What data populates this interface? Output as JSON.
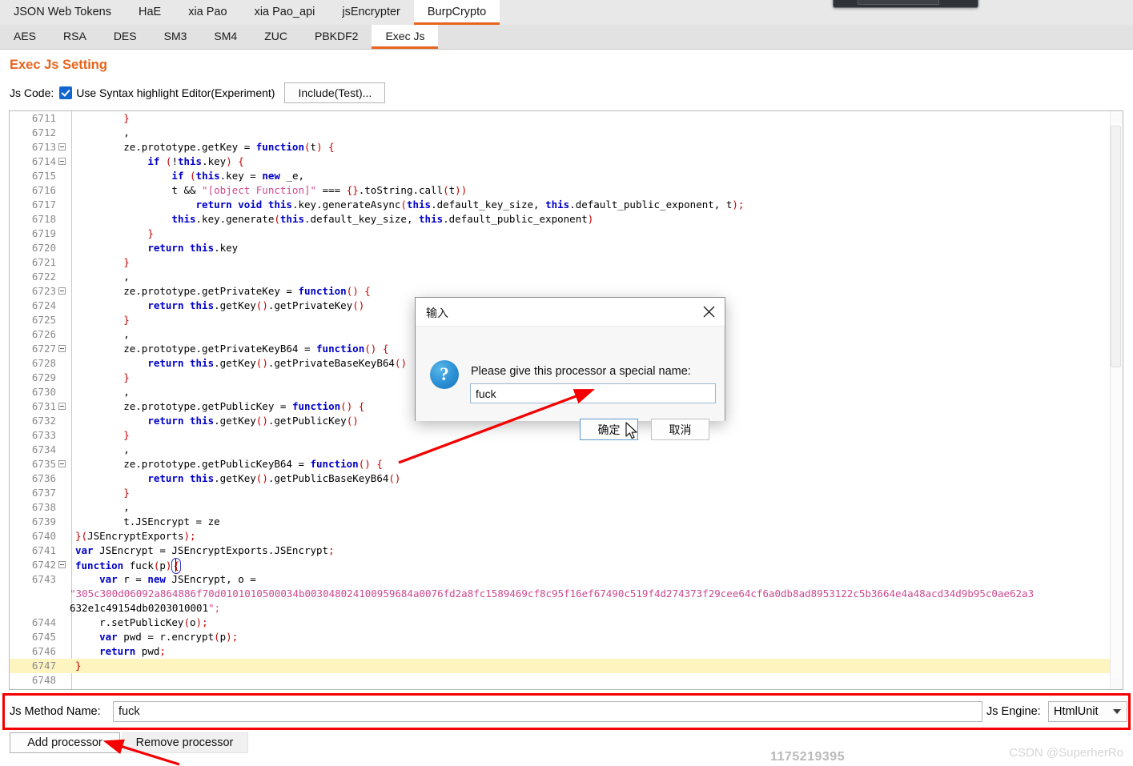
{
  "top_tabs": [
    {
      "label": "JSON Web Tokens",
      "active": false
    },
    {
      "label": "HaE",
      "active": false
    },
    {
      "label": "xia Pao",
      "active": false
    },
    {
      "label": "xia Pao_api",
      "active": false
    },
    {
      "label": "jsEncrypter",
      "active": false
    },
    {
      "label": "BurpCrypto",
      "active": true
    }
  ],
  "sub_tabs": [
    {
      "label": "AES",
      "active": false
    },
    {
      "label": "RSA",
      "active": false
    },
    {
      "label": "DES",
      "active": false
    },
    {
      "label": "SM3",
      "active": false
    },
    {
      "label": "SM4",
      "active": false
    },
    {
      "label": "ZUC",
      "active": false
    },
    {
      "label": "PBKDF2",
      "active": false
    },
    {
      "label": "Exec Js",
      "active": true
    }
  ],
  "section": {
    "title": "Exec Js Setting",
    "js_code_label": "Js Code:",
    "syntax_checkbox_label": "Use Syntax highlight Editor(Experiment)",
    "syntax_checkbox_checked": true,
    "include_button": "Include(Test)..."
  },
  "editor": {
    "first_line": 6711,
    "highlighted_line": 6747,
    "lines": [
      {
        "n": "6711",
        "fold": false,
        "text": "        }"
      },
      {
        "n": "6712",
        "fold": false,
        "text": "        ,"
      },
      {
        "n": "6713",
        "fold": true,
        "text": "        ze.prototype.getKey = function(t) {"
      },
      {
        "n": "6714",
        "fold": true,
        "text": "            if (!this.key) {"
      },
      {
        "n": "6715",
        "fold": false,
        "text": "                if (this.key = new _e,"
      },
      {
        "n": "6716",
        "fold": false,
        "text": "                t && \"[object Function]\" === {}.toString.call(t))"
      },
      {
        "n": "6717",
        "fold": false,
        "text": "                    return void this.key.generateAsync(this.default_key_size, this.default_public_exponent, t);"
      },
      {
        "n": "6718",
        "fold": false,
        "text": "                this.key.generate(this.default_key_size, this.default_public_exponent)"
      },
      {
        "n": "6719",
        "fold": false,
        "text": "            }"
      },
      {
        "n": "6720",
        "fold": false,
        "text": "            return this.key"
      },
      {
        "n": "6721",
        "fold": false,
        "text": "        }"
      },
      {
        "n": "6722",
        "fold": false,
        "text": "        ,"
      },
      {
        "n": "6723",
        "fold": true,
        "text": "        ze.prototype.getPrivateKey = function() {"
      },
      {
        "n": "6724",
        "fold": false,
        "text": "            return this.getKey().getPrivateKey()"
      },
      {
        "n": "6725",
        "fold": false,
        "text": "        }"
      },
      {
        "n": "6726",
        "fold": false,
        "text": "        ,"
      },
      {
        "n": "6727",
        "fold": true,
        "text": "        ze.prototype.getPrivateKeyB64 = function() {"
      },
      {
        "n": "6728",
        "fold": false,
        "text": "            return this.getKey().getPrivateBaseKeyB64()"
      },
      {
        "n": "6729",
        "fold": false,
        "text": "        }"
      },
      {
        "n": "6730",
        "fold": false,
        "text": "        ,"
      },
      {
        "n": "6731",
        "fold": true,
        "text": "        ze.prototype.getPublicKey = function() {"
      },
      {
        "n": "6732",
        "fold": false,
        "text": "            return this.getKey().getPublicKey()"
      },
      {
        "n": "6733",
        "fold": false,
        "text": "        }"
      },
      {
        "n": "6734",
        "fold": false,
        "text": "        ,"
      },
      {
        "n": "6735",
        "fold": true,
        "text": "        ze.prototype.getPublicKeyB64 = function() {"
      },
      {
        "n": "6736",
        "fold": false,
        "text": "            return this.getKey().getPublicBaseKeyB64()"
      },
      {
        "n": "6737",
        "fold": false,
        "text": "        }"
      },
      {
        "n": "6738",
        "fold": false,
        "text": "        ,"
      },
      {
        "n": "6739",
        "fold": false,
        "text": "        t.JSEncrypt = ze"
      },
      {
        "n": "6740",
        "fold": false,
        "text": "}(JSEncryptExports);"
      },
      {
        "n": "6741",
        "fold": false,
        "text": "var JSEncrypt = JSEncryptExports.JSEncrypt;"
      },
      {
        "n": "6742",
        "fold": true,
        "text": "function fuck(p){"
      },
      {
        "n": "6743",
        "fold": false,
        "text": "    var r = new JSEncrypt, o ="
      },
      {
        "n": "",
        "fold": false,
        "text": "\"305c300d06092a864886f70d0101010500034b003048024100959684a0076fd2a8fc1589469cf8c95f16ef67490c519f4d274373f29cee64cf6a0db8ad8953122c5b3664e4a48acd34d9b95c0ae62a3"
      },
      {
        "n": "",
        "fold": false,
        "text": "632e1c49154db0203010001\";"
      },
      {
        "n": "6744",
        "fold": false,
        "text": "    r.setPublicKey(o);"
      },
      {
        "n": "6745",
        "fold": false,
        "text": "    var pwd = r.encrypt(p);"
      },
      {
        "n": "6746",
        "fold": false,
        "text": "    return pwd;"
      },
      {
        "n": "6747",
        "fold": false,
        "text": "}"
      },
      {
        "n": "6748",
        "fold": false,
        "text": ""
      }
    ]
  },
  "dialog": {
    "title": "输入",
    "prompt": "Please give this processor a special name:",
    "input_value": "fuck",
    "ok_button": "确定",
    "cancel_button": "取消",
    "close_icon": "close-icon",
    "question_glyph": "?"
  },
  "bottom": {
    "method_label": "Js Method Name:",
    "method_value": "fuck",
    "engine_label": "Js Engine:",
    "engine_value": "HtmlUnit",
    "engine_options": [
      "HtmlUnit"
    ],
    "add_processor": "Add processor",
    "remove_processor": "Remove processor"
  },
  "watermark": {
    "number": "1175219395",
    "credit": "CSDN @SuperherRo"
  },
  "colors": {
    "accent": "#e8641c",
    "annotation_red": "#f40000",
    "keyword_blue": "#0000c8",
    "punct_red": "#c40000",
    "string_pink": "#cc4a8f",
    "highlight_yellow": "#fdf4c0",
    "checkbox_blue": "#1266cf"
  }
}
